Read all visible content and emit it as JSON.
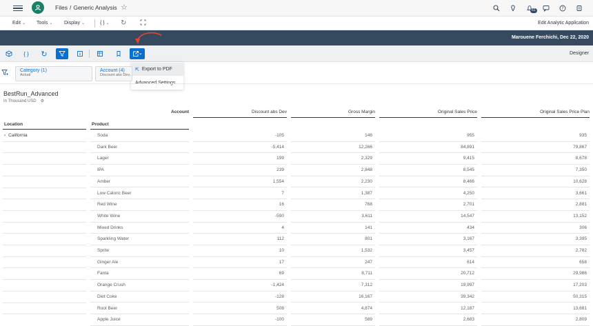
{
  "shell": {
    "breadcrumb_files": "Files",
    "breadcrumb_sep": "/",
    "breadcrumb_current": "Generic Analysis",
    "notification_count": "61"
  },
  "menubar": {
    "items": [
      "Edit",
      "Tools",
      "Display",
      "{ }"
    ],
    "edit_app_label": "Edit Analytic Application"
  },
  "userbar": {
    "user": "Marouene Ferchichi, Dec 22, 2020"
  },
  "toolbar": {
    "designer_label": "Designer"
  },
  "export_menu": {
    "items": [
      "Export to PDF",
      "Advanced Settings"
    ]
  },
  "filters": [
    {
      "title": "Category (1)",
      "value": "Actual"
    },
    {
      "title": "Account (4)",
      "value": "Discount abs Dev..."
    }
  ],
  "table": {
    "title": "BestRun_Advanced",
    "subtitle": "In Thousand USD",
    "account_label": "Account",
    "location_label": "Location",
    "product_label": "Product",
    "location_value": "California",
    "columns": [
      "Discount abs Dev",
      "Gross Margin",
      "Original Sales Price",
      "Original Sales Price Plan"
    ],
    "rows": [
      {
        "product": "Soda",
        "values": [
          "-105",
          "146",
          "955",
          "935"
        ]
      },
      {
        "product": "Dark Beer",
        "values": [
          "-5,414",
          "12,266",
          "84,891",
          "79,867"
        ]
      },
      {
        "product": "Lager",
        "values": [
          "199",
          "2,329",
          "9,415",
          "8,678"
        ]
      },
      {
        "product": "IPA",
        "values": [
          "239",
          "2,848",
          "8,545",
          "7,350"
        ]
      },
      {
        "product": "Amber",
        "values": [
          "1,554",
          "2,230",
          "8,466",
          "10,628"
        ]
      },
      {
        "product": "Low Caloric Beer",
        "values": [
          "7",
          "1,387",
          "4,250",
          "3,661"
        ]
      },
      {
        "product": "Red Wine",
        "values": [
          "16",
          "768",
          "2,701",
          "2,881"
        ]
      },
      {
        "product": "White Wine",
        "values": [
          "-590",
          "3,611",
          "14,547",
          "13,152"
        ]
      },
      {
        "product": "Mixed Drinks",
        "values": [
          "4",
          "141",
          "434",
          "306"
        ]
      },
      {
        "product": "Sparkling Water",
        "values": [
          "112",
          "801",
          "3,167",
          "3,395"
        ]
      },
      {
        "product": "Sprite",
        "values": [
          "10",
          "1,532",
          "3,457",
          "2,782"
        ]
      },
      {
        "product": "Ginger Ale",
        "values": [
          "17",
          "247",
          "614",
          "658"
        ]
      },
      {
        "product": "Fanta",
        "values": [
          "69",
          "8,711",
          "20,712",
          "29,986"
        ]
      },
      {
        "product": "Orange Crush",
        "values": [
          "-1,424",
          "7,312",
          "19,997",
          "17,203"
        ]
      },
      {
        "product": "Diet Coke",
        "values": [
          "-128",
          "16,167",
          "39,342",
          "50,315"
        ]
      },
      {
        "product": "Root Beer",
        "values": [
          "508",
          "4,874",
          "12,187",
          "13,681"
        ]
      },
      {
        "product": "Apple Juice",
        "values": [
          "-100",
          "589",
          "2,683",
          "2,809"
        ]
      }
    ]
  }
}
